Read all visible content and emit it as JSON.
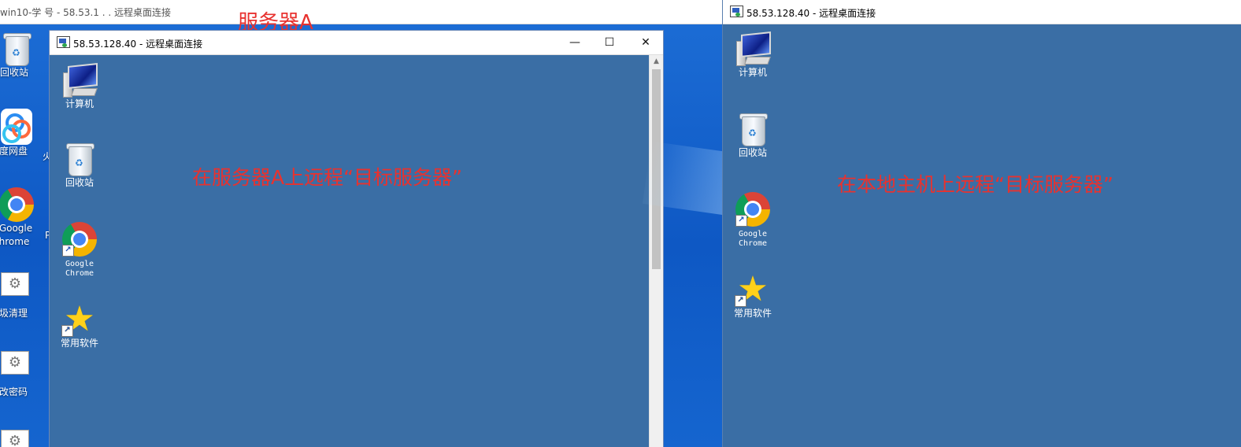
{
  "host": {
    "title": "win10-学 号 - 58.53.1 . .  远程桌面连接",
    "annotation": "服务器A",
    "icons": [
      {
        "label": "回收站",
        "icon": "recycle-bin-icon"
      },
      {
        "label": "度网盘",
        "icon": "baidu-netdisk-icon"
      },
      {
        "label_line1": "Google",
        "label_line2": "hrome",
        "icon": "chrome-icon"
      },
      {
        "label": "圾清理",
        "icon": "gear-icon"
      },
      {
        "label": "改密码",
        "icon": "gear-icon"
      }
    ],
    "truncated_labels": [
      "火",
      "P"
    ]
  },
  "rdp_a": {
    "title": "58.53.128.40 - 远程桌面连接",
    "minimize": "—",
    "maximize": "☐",
    "close": "✕",
    "icons": [
      {
        "label": "计算机",
        "icon": "computer-icon"
      },
      {
        "label": "回收站",
        "icon": "recycle-bin-icon"
      },
      {
        "label_line1": "Google",
        "label_line2": "Chrome",
        "icon": "chrome-icon"
      },
      {
        "label": "常用软件",
        "icon": "star-icon"
      }
    ],
    "annotation": "在服务器A上远程“目标服务器”"
  },
  "rdp_b": {
    "title": "58.53.128.40 - 远程桌面连接",
    "icons": [
      {
        "label": "计算机",
        "icon": "computer-icon"
      },
      {
        "label": "回收站",
        "icon": "recycle-bin-icon"
      },
      {
        "label_line1": "Google",
        "label_line2": "Chrome",
        "icon": "chrome-icon"
      },
      {
        "label": "常用软件",
        "icon": "star-icon"
      }
    ],
    "annotation": "在本地主机上远程“目标服务器”"
  },
  "colors": {
    "annotation": "#e8322f",
    "remote_desktop": "#3a6ea5",
    "host_desktop": "#1565cf"
  }
}
